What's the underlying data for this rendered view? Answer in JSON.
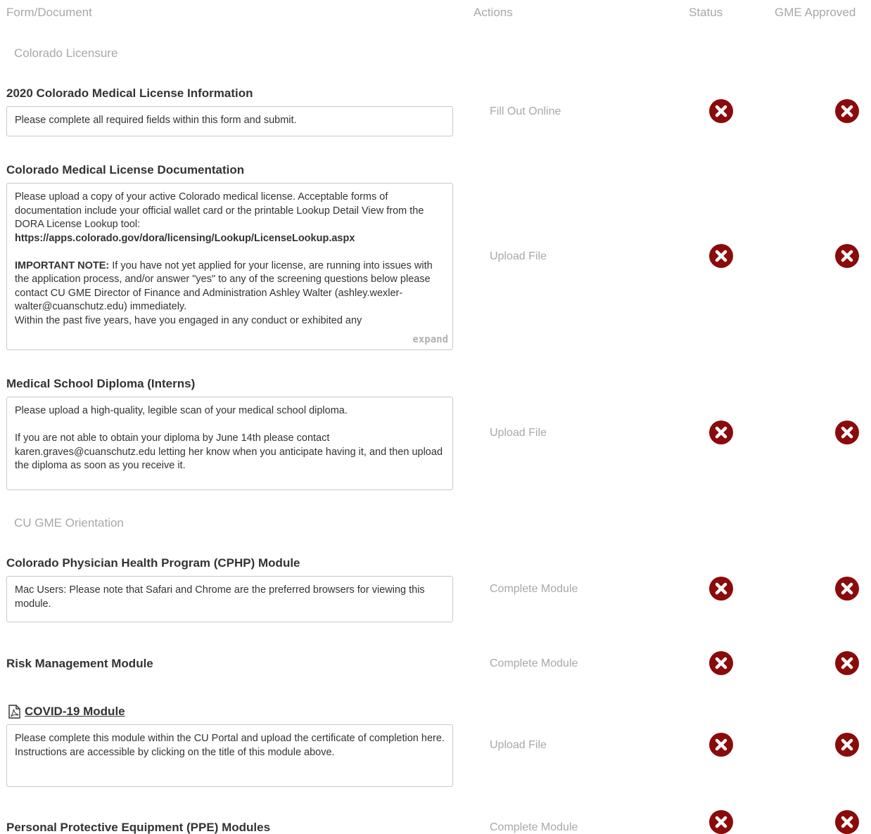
{
  "header": {
    "form_document": "Form/Document",
    "actions": "Actions",
    "status": "Status",
    "gme_approved": "GME Approved"
  },
  "sections": [
    {
      "title": "Colorado Licensure"
    },
    {
      "title": "CU GME Orientation"
    }
  ],
  "items": [
    {
      "title": "2020 Colorado Medical License Information",
      "description": [
        "Please complete all required fields within this form and submit."
      ],
      "action": "Fill Out Online",
      "status": "x-circle-icon",
      "gme_approved": "x-circle-icon"
    },
    {
      "title": "Colorado Medical License Documentation",
      "description": [
        "Please upload a copy of your active Colorado medical license. Acceptable forms of documentation include your official wallet card or the printable Lookup Detail View from the DORA License Lookup tool:",
        "https://apps.colorado.gov/dora/licensing/Lookup/LicenseLookup.aspx",
        "IMPORTANT NOTE:",
        " If you have not yet applied for your license, are running into issues with the application process, and/or answer \"yes\" to any of the screening questions below please contact CU GME Director of Finance and Administration Ashley Walter (ashley.wexler-walter@cuanschutz.edu) immediately.",
        "Within the past five years, have you engaged in any conduct or exhibited any"
      ],
      "expand_label": "expand",
      "action": "Upload File",
      "status": "x-circle-icon",
      "gme_approved": "x-circle-icon"
    },
    {
      "title": "Medical School Diploma (Interns)",
      "description": [
        "Please upload a high-quality, legible scan of your medical school diploma.",
        "If you are not able to obtain your diploma by June 14th please contact karen.graves@cuanschutz.edu letting her know when you anticipate having it, and then upload the diploma as soon as you receive it."
      ],
      "action": "Upload File",
      "status": "x-circle-icon",
      "gme_approved": "x-circle-icon"
    },
    {
      "title": "Colorado Physician Health Program (CPHP) Module",
      "description": [
        "Mac Users: Please note that Safari and Chrome are the preferred browsers for viewing this module."
      ],
      "action": "Complete Module",
      "status": "x-circle-icon",
      "gme_approved": "x-circle-icon"
    },
    {
      "title": "Risk Management Module",
      "action": "Complete Module",
      "status": "x-circle-icon",
      "gme_approved": "x-circle-icon"
    },
    {
      "title": "COVID-19 Module",
      "title_icon": "pdf-file-icon",
      "description": [
        "Please complete this module within the CU Portal and upload the certificate of completion here. Instructions are accessible by clicking on the title of this module above."
      ],
      "action": "Upload File",
      "status": "x-circle-icon",
      "gme_approved": "x-circle-icon"
    },
    {
      "title": "Personal Protective Equipment (PPE) Modules",
      "action": "Complete Module",
      "status": "x-circle-icon",
      "gme_approved": "x-circle-icon"
    }
  ],
  "colors": {
    "status_incomplete": "#8b0a0a",
    "muted_text": "#a8a8a8"
  }
}
